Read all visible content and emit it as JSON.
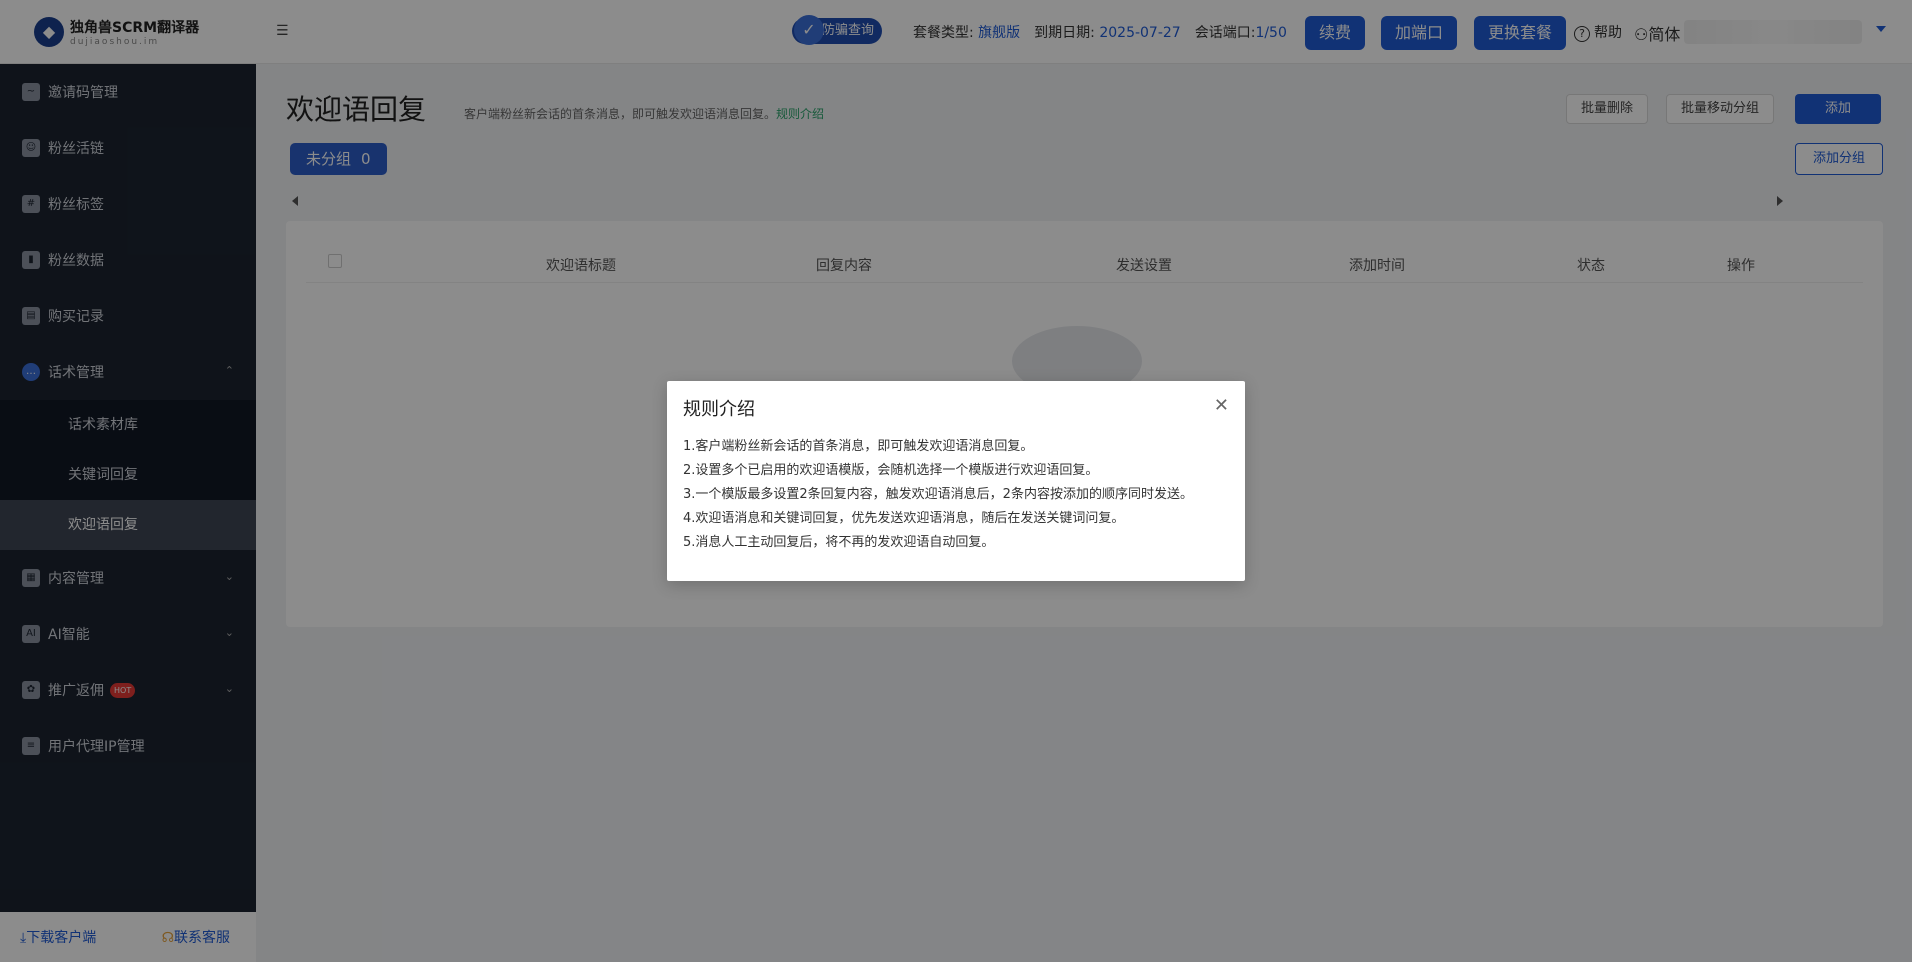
{
  "header": {
    "logo_title": "独角兽SCRM翻译器",
    "logo_sub": "dujiaoshou.im",
    "anti_fraud": "防骗查询",
    "plan_type_label": "套餐类型:",
    "plan_type_value": "旗舰版",
    "expire_label": "到期日期:",
    "expire_value": "2025-07-27",
    "ports_label": "会话端口:",
    "ports_value": "1/50",
    "renew": "续费",
    "add_port": "加端口",
    "change_plan": "更换套餐",
    "help": "帮助",
    "lang": "简体"
  },
  "sidebar": {
    "items": [
      {
        "label": "邀请码管理",
        "icon": "chart-icon"
      },
      {
        "label": "粉丝活链",
        "icon": "users-icon"
      },
      {
        "label": "粉丝标签",
        "icon": "tag-icon"
      },
      {
        "label": "粉丝数据",
        "icon": "bar-chart-icon"
      },
      {
        "label": "购买记录",
        "icon": "bag-icon"
      },
      {
        "label": "话术管理",
        "icon": "chat-icon"
      }
    ],
    "sub_items": [
      "话术素材库",
      "关键词回复",
      "欢迎语回复"
    ],
    "items_after": [
      {
        "label": "内容管理",
        "icon": "content-icon"
      },
      {
        "label": "AI智能",
        "icon": "ai-icon"
      },
      {
        "label": "推广返佣",
        "icon": "gift-icon",
        "badge": "HOT"
      },
      {
        "label": "用户代理IP管理",
        "icon": "server-icon"
      }
    ],
    "download": "下载客户端",
    "contact": "联系客服"
  },
  "main": {
    "title": "欢迎语回复",
    "desc": "客户端粉丝新会话的首条消息，即可触发欢迎语消息回复。",
    "rules_link": "规则介绍",
    "batch_delete": "批量删除",
    "batch_move": "批量移动分组",
    "add": "添加",
    "group_name": "未分组",
    "group_count": "0",
    "add_group": "添加分组",
    "columns": [
      "欢迎语标题",
      "回复内容",
      "发送设置",
      "添加时间",
      "状态",
      "操作"
    ]
  },
  "dialog": {
    "title": "规则介绍",
    "lines": [
      "1.客户端粉丝新会话的首条消息，即可触发欢迎语消息回复。",
      "2.设置多个已启用的欢迎语模版，会随机选择一个模版进行欢迎语回复。",
      "3.一个模版最多设置2条回复内容，触发欢迎语消息后，2条内容按添加的顺序同时发送。",
      "4.欢迎语消息和关键词回复，优先发送欢迎语消息，随后在发送关键词问复。",
      "5.消息人工主动回复后，将不再的发欢迎语自动回复。"
    ]
  }
}
